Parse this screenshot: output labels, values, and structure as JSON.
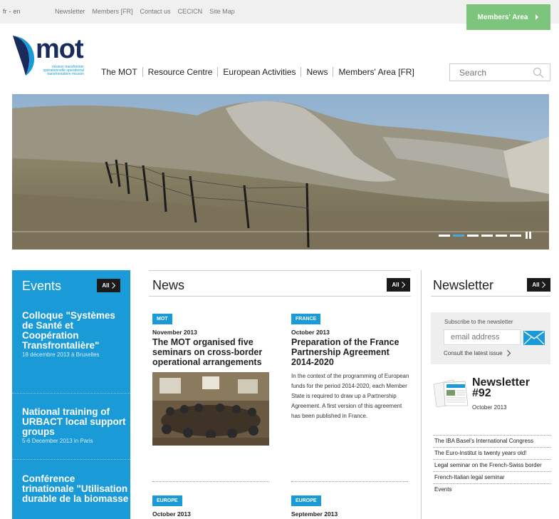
{
  "topbar": {
    "lang_fr": "fr",
    "lang_sep": "-",
    "lang_en": "en",
    "links": [
      "Newsletter",
      "Members [FR]",
      "Contact us",
      "CECICN",
      "Site Map"
    ],
    "members_area": "Members' Area"
  },
  "logo": {
    "word": "mot",
    "sub_lines": [
      "mission transfrontier",
      "opérationnelle operational",
      "transfrontalière mission"
    ]
  },
  "nav": [
    "The MOT",
    "Resource Centre",
    "European Activities",
    "News",
    "Members' Area [FR]"
  ],
  "search": {
    "placeholder": "Search"
  },
  "events": {
    "heading": "Events",
    "all_label": "All",
    "items": [
      {
        "title": "Colloque \"Systèmes de Santé et Coopération Transfrontalière\"",
        "date": "18 décembre 2013 à Bruxelles"
      },
      {
        "title": "National training of URBACT local support groups",
        "date": "5-6 December 2013 in Paris"
      },
      {
        "title": "Conférence trinationale \"Utilisation durable de la biomasse",
        "date": ""
      }
    ]
  },
  "news": {
    "heading": "News",
    "all_label": "All",
    "articles": [
      {
        "tag": "MOT",
        "date": "November 2013",
        "title": "The MOT organised five seminars on cross-border operational arrangements",
        "text": ""
      },
      {
        "tag": "FRANCE",
        "date": "October 2013",
        "title": "Preparation of the France Partnership Agreement 2014-2020",
        "text": "In the context of the programming of European funds for the period 2014-2020, each Member State is required to draw up a Partnership Agreement. A first version of this agreement has been published in France."
      },
      {
        "tag": "EUROPE",
        "date": "October 2013",
        "title": "",
        "text": ""
      },
      {
        "tag": "EUROPE",
        "date": "September 2013",
        "title": "",
        "text": ""
      }
    ]
  },
  "newsletter": {
    "heading": "Newsletter",
    "all_label": "All",
    "subscribe_label": "Subscribe to the newsletter",
    "email_placeholder": "email address",
    "latest_label": "Consult the latest issue",
    "issue_title": "Newsletter #92",
    "issue_date": "October 2013",
    "list": [
      "The IBA Basel's International Congress",
      "The Euro-Institut is twenty years old!",
      "Legal seminar on the French-Swiss border",
      "French-Italian legal seminar",
      "Events"
    ]
  },
  "colors": {
    "accent": "#1a9ad6",
    "members_green": "#7dc47d",
    "dark": "#1a1a1a"
  },
  "slider": {
    "slides": 6,
    "active": 2
  }
}
